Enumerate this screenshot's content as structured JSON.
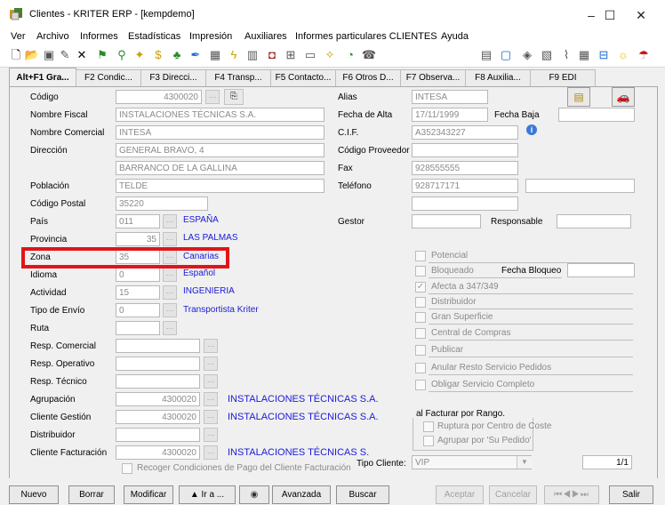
{
  "window": {
    "title": "Clientes - KRITER ERP - [kempdemo]",
    "minimize": "–",
    "maximize": "☐",
    "close": "✕"
  },
  "menu": [
    "Ver",
    "Archivo",
    "Informes",
    "Estadísticas",
    "Impresión",
    "Auxiliares",
    "Informes particulares CLIENTES",
    "Ayuda"
  ],
  "tabs": [
    "Alt+F1 Gra...",
    "F2 Condic...",
    "F3 Direcci...",
    "F4 Transp...",
    "F5 Contacto...",
    "F6 Otros D...",
    "F7 Observa...",
    "F8 Auxilia...",
    "F9 EDI"
  ],
  "left": {
    "codigo_label": "Código",
    "codigo": "4300020",
    "nombre_fiscal_label": "Nombre Fiscal",
    "nombre_fiscal": "INSTALACIONES TÉCNICAS S.A.",
    "nombre_comercial_label": "Nombre Comercial",
    "nombre_comercial": "INTESA",
    "direccion_label": "Dirección",
    "direccion1": "GENERAL BRAVO, 4",
    "direccion2": "BARRANCO DE LA GALLINA",
    "poblacion_label": "Población",
    "poblacion": "TELDE",
    "cp_label": "Código Postal",
    "cp": "35220",
    "pais_label": "País",
    "pais_code": "011",
    "pais_name": "ESPAÑA",
    "provincia_label": "Provincia",
    "provincia_code": "35",
    "provincia_name": "LAS PALMAS",
    "zona_label": "Zona",
    "zona_code": "35",
    "zona_name": "Canarias",
    "idioma_label": "Idioma",
    "idioma_code": "0",
    "idioma_name": "Español",
    "actividad_label": "Actividad",
    "actividad_code": "15",
    "actividad_name": "INGENIERIA",
    "envio_label": "Tipo de Envío",
    "envio_code": "0",
    "envio_name": "Transportista Kriter",
    "ruta_label": "Ruta",
    "resp_comercial_label": "Resp. Comercial",
    "resp_operativo_label": "Resp. Operativo",
    "resp_tecnico_label": "Resp. Técnico",
    "agrupacion_label": "Agrupación",
    "agrupacion_code": "4300020",
    "agrupacion_name": "INSTALACIONES TÉCNICAS S.A.",
    "gestion_label": "Cliente Gestión",
    "gestion_code": "4300020",
    "gestion_name": "INSTALACIONES TÉCNICAS S.A.",
    "distribuidor_label": "Distribuidor",
    "facturacion_label": "Cliente Facturación",
    "facturacion_code": "4300020",
    "facturacion_name": "INSTALACIONES TÉCNICAS S.",
    "recoger_label": "Recoger Condiciones de Pago del Cliente Facturación"
  },
  "right": {
    "alias_label": "Alias",
    "alias": "INTESA",
    "alta_label": "Fecha de Alta",
    "alta": "17/11/1999",
    "baja_label": "Fecha Baja",
    "cif_label": "C.I.F.",
    "cif": "A352343227",
    "proveedor_label": "Código Proveedor",
    "fax_label": "Fax",
    "fax": "928555555",
    "telefono_label": "Teléfono",
    "telefono": "928717171",
    "gestor_label": "Gestor",
    "responsable_label": "Responsable",
    "checks": {
      "potencial": "Potencial",
      "bloqueado": "Bloqueado",
      "fecha_bloqueo": "Fecha Bloqueo",
      "afecta": "Afecta a 347/349",
      "distribuidor": "Distribuidor",
      "gran_superficie": "Gran Superficie",
      "central": "Central de Compras",
      "publicar": "Publicar",
      "anular": "Anular Resto Servicio Pedidos",
      "obligar": "Obligar Servicio Completo"
    },
    "rango_label": "al Facturar por Rango.",
    "ruptura": "Ruptura por Centro de Coste",
    "agrupar": "Agrupar por 'Su Pedido'",
    "tipo_cliente_label": "Tipo Cliente:",
    "tipo_cliente": "VIP",
    "page": "1/1"
  },
  "buttons": {
    "nuevo": "Nuevo",
    "borrar": "Borrar",
    "modificar": "Modificar",
    "ira": "▲ Ir a ...",
    "avanzada": "Avanzada",
    "buscar": "Buscar",
    "aceptar": "Aceptar",
    "cancelar": "Cancelar",
    "salir": "Salir"
  },
  "colors": {
    "link": "#1a1ad8",
    "highlight": "#e0151a"
  }
}
